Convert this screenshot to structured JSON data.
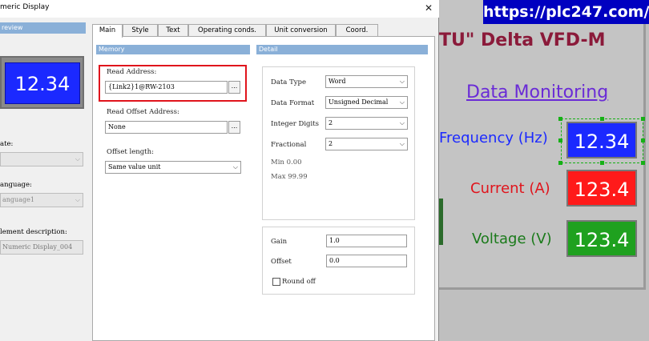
{
  "dialog": {
    "title": "meric Display",
    "close_glyph": "✕"
  },
  "preview": {
    "header": "review",
    "value": "12.34"
  },
  "side": {
    "state_label": "ate:",
    "language_label": "anguage:",
    "language_value": "anguage1",
    "description_label": "lement description:",
    "description_value": "Numeric Display_004"
  },
  "tabs": [
    {
      "label": "Main",
      "active": true
    },
    {
      "label": "Style",
      "active": false
    },
    {
      "label": "Text",
      "active": false
    },
    {
      "label": "Operating conds.",
      "active": false
    },
    {
      "label": "Unit conversion",
      "active": false
    },
    {
      "label": "Coord.",
      "active": false
    }
  ],
  "memory": {
    "title": "Memory",
    "read_address_label": "Read Address:",
    "read_address_value": "{Link2}1@RW-2103",
    "read_offset_label": "Read Offset Address:",
    "read_offset_value": "None",
    "offset_length_label": "Offset length:",
    "offset_length_value": "Same value unit",
    "dots": "..."
  },
  "detail": {
    "title": "Detail",
    "data_type_label": "Data Type",
    "data_type_value": "Word",
    "data_format_label": "Data Format",
    "data_format_value": "Unsigned Decimal",
    "integer_digits_label": "Integer Digits",
    "integer_digits_value": "2",
    "fractional_label": "Fractional",
    "fractional_value": "2",
    "min_text": "Min 0.00",
    "max_text": "Max 99.99",
    "gain_label": "Gain",
    "gain_value": "1.0",
    "offset_label": "Offset",
    "offset_value": "0.0",
    "round_off_label": "Round off",
    "round_off_checked": false
  },
  "hmi": {
    "url": "https://plc247.com/",
    "title": "TU\" Delta VFD-M",
    "section_title": "Data Monitoring",
    "frequency_label": "Frequency (Hz)",
    "frequency_value": "12.34",
    "current_label": "Current (A)",
    "current_value": "123.4",
    "voltage_label": "Voltage (V)",
    "voltage_value": "123.4"
  },
  "colors": {
    "header_blue": "#8ab0d8",
    "highlight_red": "#e0141c",
    "display_blue": "#1b29ff",
    "display_red": "#ff1a1a",
    "display_green": "#1fa11f",
    "url_banner": "#0000c0",
    "title_maroon": "#8b1a3a",
    "link_purple": "#6a2bd6"
  },
  "icons": {
    "close": "close-icon",
    "dropdown": "chevron-down-icon",
    "browse": "ellipsis-icon"
  }
}
